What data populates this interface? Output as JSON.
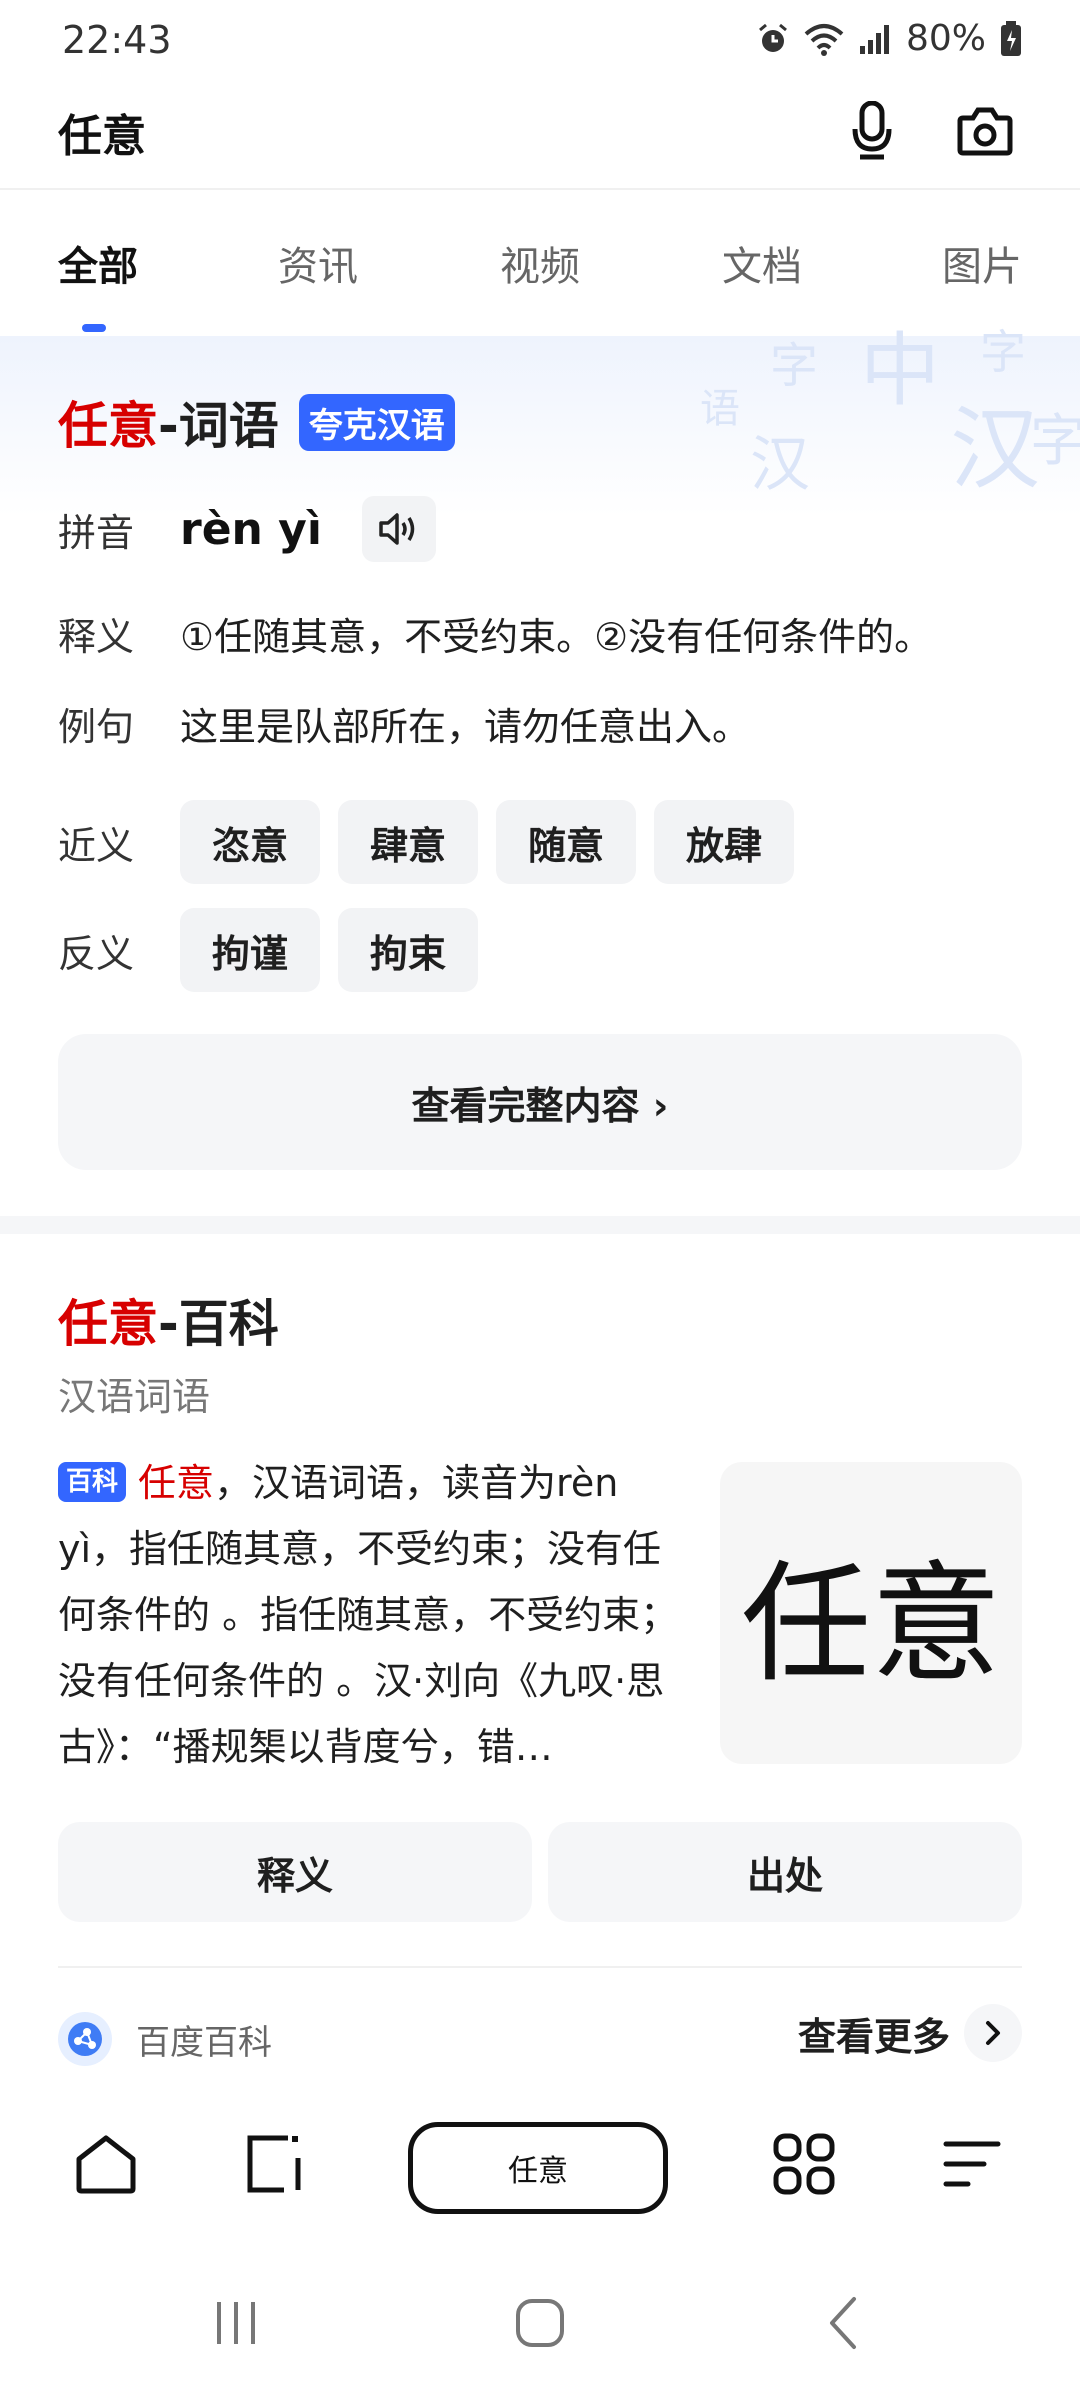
{
  "status": {
    "time": "22:43",
    "battery": "80%"
  },
  "header": {
    "query": "任意"
  },
  "tabs": [
    {
      "label": "全部"
    },
    {
      "label": "资讯"
    },
    {
      "label": "视频"
    },
    {
      "label": "文档"
    },
    {
      "label": "图片"
    }
  ],
  "dict": {
    "title_red": "任意",
    "title_rest": "-词语",
    "badge": "夸克汉语",
    "decor_chars": [
      "字",
      "中",
      "汉",
      "字",
      "语",
      "汉",
      "字"
    ],
    "pinyin_label": "拼音",
    "pinyin": "rèn yì",
    "meaning_label": "释义",
    "meaning": "①任随其意，不受约束。②没有任何条件的。",
    "example_label": "例句",
    "example": "这里是队部所在，请勿任意出入。",
    "synonym_label": "近义",
    "synonyms": [
      "恣意",
      "肆意",
      "随意",
      "放肆"
    ],
    "antonym_label": "反义",
    "antonyms": [
      "拘谨",
      "拘束"
    ],
    "full_button": "查看完整内容 ›"
  },
  "baike": {
    "title_red": "任意",
    "title_rest": "-百科",
    "subtitle": "汉语词语",
    "tag": "百科",
    "body_red": "任意",
    "body": "，汉语词语，读音为rèn yì，指任随其意，不受约束；没有任何条件的 。指任随其意，不受约束；没有任何条件的 。汉·刘向《九叹·思古》：“播规榘以背度兮，错…",
    "image_text": "任意",
    "btn_meaning": "释义",
    "btn_source": "出处",
    "source_name": "百度百科",
    "more": "查看更多"
  },
  "bottom_bar": {
    "search_text": "任意"
  },
  "colors": {
    "accent": "#3366ff",
    "highlight": "#d70000"
  }
}
